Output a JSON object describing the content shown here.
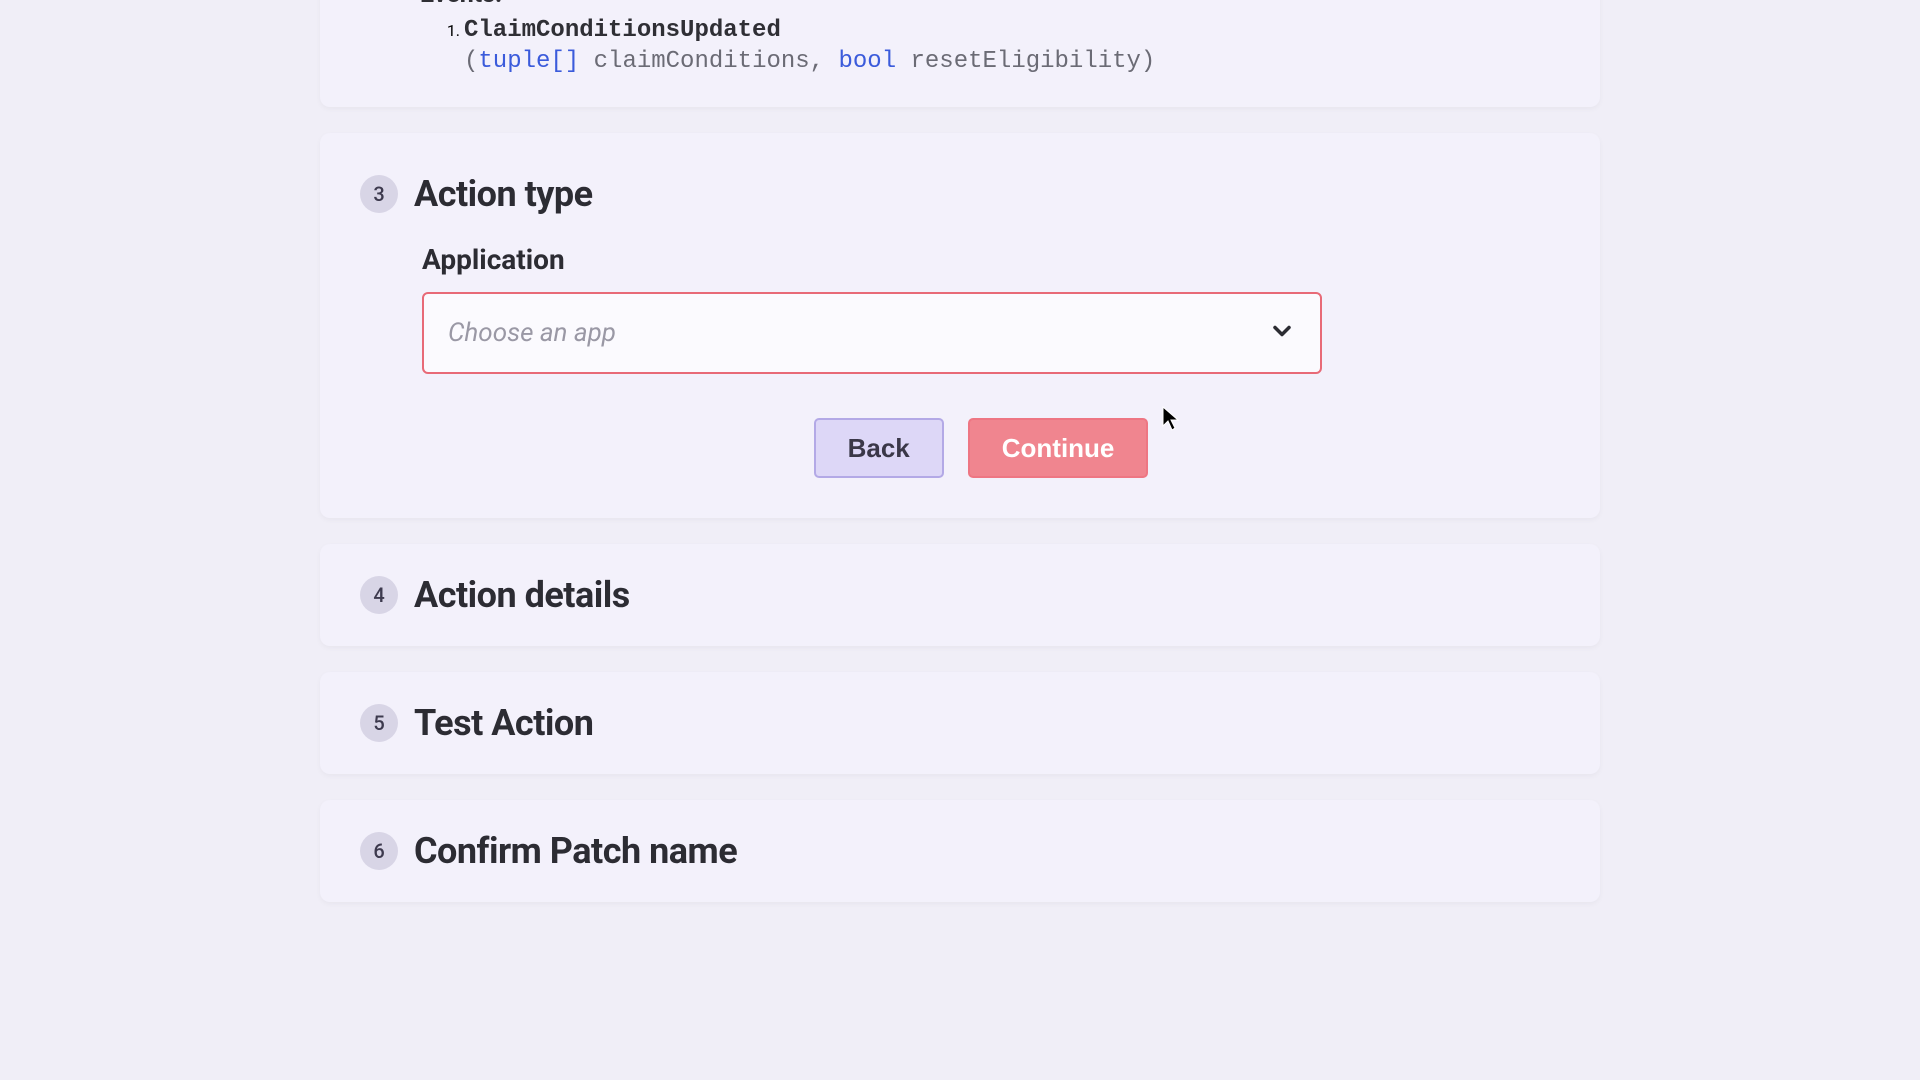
{
  "events": {
    "label": "Events:",
    "items": [
      {
        "name": "ClaimConditionsUpdated",
        "sig_open": "(",
        "sig_type1": "tuple[]",
        "sig_arg1": " claimConditions, ",
        "sig_type2": "bool",
        "sig_arg2": " resetEligibility)",
        "ordinal": "1."
      }
    ]
  },
  "steps": {
    "action_type": {
      "num": "3",
      "title": "Action type",
      "field_label": "Application",
      "placeholder": "Choose an app",
      "back": "Back",
      "continue": "Continue"
    },
    "action_details": {
      "num": "4",
      "title": "Action details"
    },
    "test_action": {
      "num": "5",
      "title": "Test Action"
    },
    "confirm_patch": {
      "num": "6",
      "title": "Confirm Patch name"
    }
  }
}
